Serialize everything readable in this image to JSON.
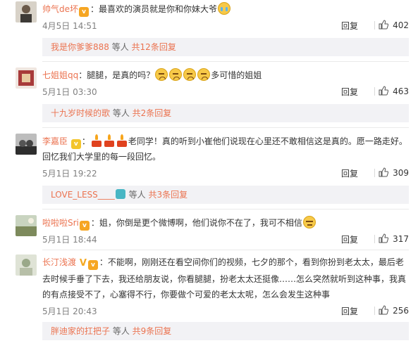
{
  "comments": [
    {
      "username": "帅气de坏",
      "text": "：最喜欢的演员就是你和你妹大爷",
      "time": "4月5日 14:51",
      "reply_label": "回复",
      "likes": "402",
      "replies": {
        "user": "我是你爹爹888",
        "mid": " 等人 ",
        "count": "共12条回复"
      },
      "avatar_color": "#6b5a4a"
    },
    {
      "username": "七姐姐qq",
      "text": "：腿腿，是真的吗？",
      "text2": "多可惜的姐姐",
      "time": "5月1日 03:30",
      "reply_label": "回复",
      "likes": "463",
      "replies": {
        "user": "十九岁时候的歌",
        "mid": " 等人 ",
        "count": "共2条回复"
      },
      "avatar_color": "#a83a3a"
    },
    {
      "username": "李嘉臣",
      "text": "老同学！真的听到小崔他们说现在心里还不敢相信这是真的。愿一路走好。回忆我们大学里的每一段回忆。",
      "time": "5月1日 19:22",
      "reply_label": "回复",
      "likes": "309",
      "replies": {
        "user": "LOVE_LESS____",
        "mid": " 等人 ",
        "count": "共3条回复"
      },
      "avatar_color": "#2e2e2e"
    },
    {
      "username": "啦啦啦Sri",
      "text": "：姐，你倒是更个微博啊，他们说你不在了，我可不相信",
      "time": "5月1日 18:44",
      "reply_label": "回复",
      "likes": "317",
      "avatar_color": "#7d8a5c"
    },
    {
      "username": "长汀浅渡",
      "text": "：不能啊，刚刚还在看空间你们的视频，七夕的那个，看到你扮到老太太，最后老去时候手垂了下去，我还给朋友说，你看腿腿，扮老太太还挺像……怎么突然就听到这种事，我真的有点接受不了，心塞得不行，你要做个可爱的老太太呢，怎么会发生这种事",
      "time": "5月1日 20:43",
      "reply_label": "回复",
      "likes": "256",
      "replies": {
        "user": "胖迪家的扛把子",
        "mid": " 等人 ",
        "count": "共9条回复"
      },
      "avatar_color": "#9aa889"
    }
  ]
}
